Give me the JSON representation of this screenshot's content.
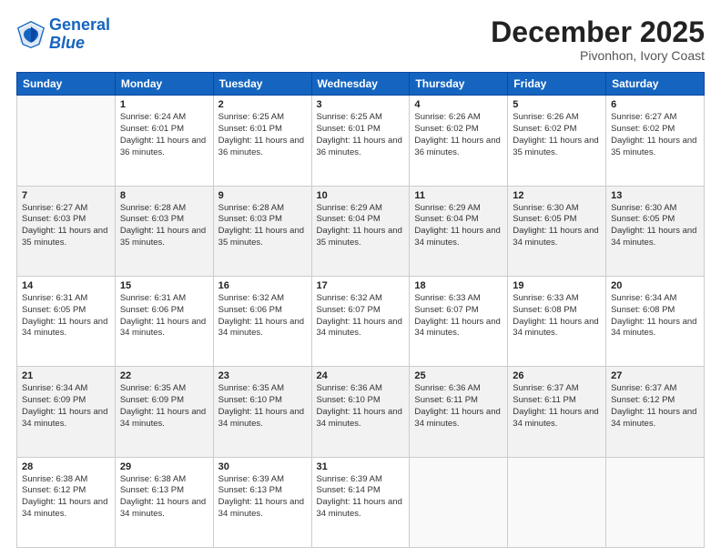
{
  "header": {
    "logo_line1": "General",
    "logo_line2": "Blue",
    "month": "December 2025",
    "location": "Pivonhon, Ivory Coast"
  },
  "weekdays": [
    "Sunday",
    "Monday",
    "Tuesday",
    "Wednesday",
    "Thursday",
    "Friday",
    "Saturday"
  ],
  "weeks": [
    [
      {
        "day": "",
        "empty": true
      },
      {
        "day": "1",
        "sunrise": "6:24 AM",
        "sunset": "6:01 PM",
        "daylight": "11 hours and 36 minutes."
      },
      {
        "day": "2",
        "sunrise": "6:25 AM",
        "sunset": "6:01 PM",
        "daylight": "11 hours and 36 minutes."
      },
      {
        "day": "3",
        "sunrise": "6:25 AM",
        "sunset": "6:01 PM",
        "daylight": "11 hours and 36 minutes."
      },
      {
        "day": "4",
        "sunrise": "6:26 AM",
        "sunset": "6:02 PM",
        "daylight": "11 hours and 36 minutes."
      },
      {
        "day": "5",
        "sunrise": "6:26 AM",
        "sunset": "6:02 PM",
        "daylight": "11 hours and 35 minutes."
      },
      {
        "day": "6",
        "sunrise": "6:27 AM",
        "sunset": "6:02 PM",
        "daylight": "11 hours and 35 minutes."
      }
    ],
    [
      {
        "day": "7",
        "sunrise": "6:27 AM",
        "sunset": "6:03 PM",
        "daylight": "11 hours and 35 minutes."
      },
      {
        "day": "8",
        "sunrise": "6:28 AM",
        "sunset": "6:03 PM",
        "daylight": "11 hours and 35 minutes."
      },
      {
        "day": "9",
        "sunrise": "6:28 AM",
        "sunset": "6:03 PM",
        "daylight": "11 hours and 35 minutes."
      },
      {
        "day": "10",
        "sunrise": "6:29 AM",
        "sunset": "6:04 PM",
        "daylight": "11 hours and 35 minutes."
      },
      {
        "day": "11",
        "sunrise": "6:29 AM",
        "sunset": "6:04 PM",
        "daylight": "11 hours and 34 minutes."
      },
      {
        "day": "12",
        "sunrise": "6:30 AM",
        "sunset": "6:05 PM",
        "daylight": "11 hours and 34 minutes."
      },
      {
        "day": "13",
        "sunrise": "6:30 AM",
        "sunset": "6:05 PM",
        "daylight": "11 hours and 34 minutes."
      }
    ],
    [
      {
        "day": "14",
        "sunrise": "6:31 AM",
        "sunset": "6:05 PM",
        "daylight": "11 hours and 34 minutes."
      },
      {
        "day": "15",
        "sunrise": "6:31 AM",
        "sunset": "6:06 PM",
        "daylight": "11 hours and 34 minutes."
      },
      {
        "day": "16",
        "sunrise": "6:32 AM",
        "sunset": "6:06 PM",
        "daylight": "11 hours and 34 minutes."
      },
      {
        "day": "17",
        "sunrise": "6:32 AM",
        "sunset": "6:07 PM",
        "daylight": "11 hours and 34 minutes."
      },
      {
        "day": "18",
        "sunrise": "6:33 AM",
        "sunset": "6:07 PM",
        "daylight": "11 hours and 34 minutes."
      },
      {
        "day": "19",
        "sunrise": "6:33 AM",
        "sunset": "6:08 PM",
        "daylight": "11 hours and 34 minutes."
      },
      {
        "day": "20",
        "sunrise": "6:34 AM",
        "sunset": "6:08 PM",
        "daylight": "11 hours and 34 minutes."
      }
    ],
    [
      {
        "day": "21",
        "sunrise": "6:34 AM",
        "sunset": "6:09 PM",
        "daylight": "11 hours and 34 minutes."
      },
      {
        "day": "22",
        "sunrise": "6:35 AM",
        "sunset": "6:09 PM",
        "daylight": "11 hours and 34 minutes."
      },
      {
        "day": "23",
        "sunrise": "6:35 AM",
        "sunset": "6:10 PM",
        "daylight": "11 hours and 34 minutes."
      },
      {
        "day": "24",
        "sunrise": "6:36 AM",
        "sunset": "6:10 PM",
        "daylight": "11 hours and 34 minutes."
      },
      {
        "day": "25",
        "sunrise": "6:36 AM",
        "sunset": "6:11 PM",
        "daylight": "11 hours and 34 minutes."
      },
      {
        "day": "26",
        "sunrise": "6:37 AM",
        "sunset": "6:11 PM",
        "daylight": "11 hours and 34 minutes."
      },
      {
        "day": "27",
        "sunrise": "6:37 AM",
        "sunset": "6:12 PM",
        "daylight": "11 hours and 34 minutes."
      }
    ],
    [
      {
        "day": "28",
        "sunrise": "6:38 AM",
        "sunset": "6:12 PM",
        "daylight": "11 hours and 34 minutes."
      },
      {
        "day": "29",
        "sunrise": "6:38 AM",
        "sunset": "6:13 PM",
        "daylight": "11 hours and 34 minutes."
      },
      {
        "day": "30",
        "sunrise": "6:39 AM",
        "sunset": "6:13 PM",
        "daylight": "11 hours and 34 minutes."
      },
      {
        "day": "31",
        "sunrise": "6:39 AM",
        "sunset": "6:14 PM",
        "daylight": "11 hours and 34 minutes."
      },
      {
        "day": "",
        "empty": true
      },
      {
        "day": "",
        "empty": true
      },
      {
        "day": "",
        "empty": true
      }
    ]
  ],
  "labels": {
    "sunrise_prefix": "Sunrise: ",
    "sunset_prefix": "Sunset: ",
    "daylight_prefix": "Daylight: "
  }
}
